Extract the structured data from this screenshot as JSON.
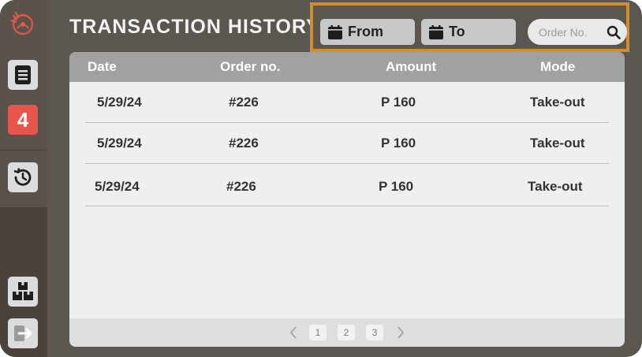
{
  "page": {
    "title": "TRANSACTION HISTORY"
  },
  "sidebar": {
    "badge": "4",
    "items": [
      {
        "name": "logo",
        "icon": "logo-icon"
      },
      {
        "name": "orders",
        "icon": "document-icon"
      },
      {
        "name": "pending-count",
        "icon": "badge"
      },
      {
        "name": "history",
        "icon": "history-icon"
      },
      {
        "name": "inventory",
        "icon": "boxes-icon"
      },
      {
        "name": "logout",
        "icon": "logout-icon"
      }
    ]
  },
  "filters": {
    "from_label": "From",
    "to_label": "To",
    "search_placeholder": "Order No.",
    "accent_color": "#d08f2e"
  },
  "table": {
    "headers": {
      "date": "Date",
      "order": "Order no.",
      "amount": "Amount",
      "mode": "Mode"
    },
    "rows": [
      {
        "date": "5/29/24",
        "order": "#226",
        "amount": "P 160",
        "mode": "Take-out"
      },
      {
        "date": "5/29/24",
        "order": "#226",
        "amount": "P 160",
        "mode": "Take-out"
      },
      {
        "date": "5/29/24",
        "order": "#226",
        "amount": "P 160",
        "mode": "Take-out"
      }
    ]
  },
  "pagination": {
    "pages": [
      "1",
      "2",
      "3"
    ]
  }
}
